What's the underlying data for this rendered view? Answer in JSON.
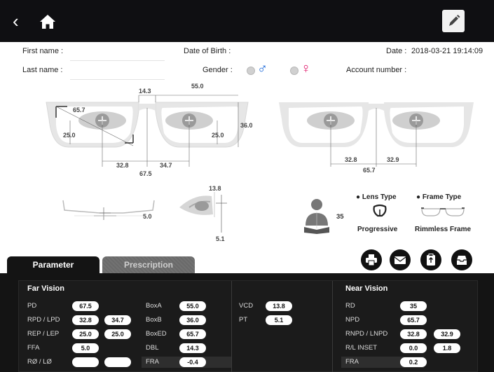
{
  "patient": {
    "first_name_label": "First name :",
    "last_name_label": "Last name :",
    "dob_label": "Date of Birth :",
    "gender_label": "Gender :",
    "date_label": "Date :",
    "date_value": "2018-03-21 19:14:09",
    "account_label": "Account number :",
    "male_symbol": "♂",
    "female_symbol": "♀",
    "male_color": "#1565d8",
    "female_color": "#e0196c"
  },
  "frame_front": {
    "bridge": "14.3",
    "lens_width": "55.0",
    "ffa_angle": "65.7",
    "left_height": "25.0",
    "right_height": "25.0",
    "frame_height": "36.0",
    "left_pd": "32.8",
    "right_pd": "34.7",
    "total_pd": "67.5"
  },
  "frame_near": {
    "left_pd": "32.8",
    "right_pd": "32.9",
    "total_pd": "65.7"
  },
  "wrap": {
    "value": "5.0"
  },
  "side": {
    "vcd": "13.8",
    "pantoscopic": "5.1"
  },
  "reading": {
    "distance": "35"
  },
  "types": {
    "lens_label": "Lens Type",
    "frame_label": "Frame Type",
    "lens_value": "Progressive",
    "frame_value": "Rimmless Frame"
  },
  "tabs": {
    "parameter": "Parameter",
    "prescription": "Prescription"
  },
  "far": {
    "title": "Far Vision",
    "pd_label": "PD",
    "pd": "67.5",
    "rpd_label": "RPD / LPD",
    "rpd": "32.8",
    "lpd": "34.7",
    "rep_label": "REP / LEP",
    "rep": "25.0",
    "lep": "25.0",
    "ffa_label": "FFA",
    "ffa": "5.0",
    "rl_label": "RØ / LØ",
    "r0": "",
    "l0": "",
    "boxa_label": "BoxA",
    "boxa": "55.0",
    "boxb_label": "BoxB",
    "boxb": "36.0",
    "boxed_label": "BoxED",
    "boxed": "65.7",
    "dbl_label": "DBL",
    "dbl": "14.3",
    "fra_label": "FRA",
    "fra": "-0.4"
  },
  "mid": {
    "vcd_label": "VCD",
    "vcd": "13.8",
    "pt_label": "PT",
    "pt": "5.1"
  },
  "near": {
    "title": "Near Vision",
    "rd_label": "RD",
    "rd": "35",
    "npd_label": "NPD",
    "npd": "65.7",
    "rnpd_label": "RNPD / LNPD",
    "rnpd": "32.8",
    "lnpd": "32.9",
    "inset_label": "R/L INSET",
    "rinset": "0.0",
    "linset": "1.8",
    "fra_label": "FRA",
    "fra": "0.2"
  }
}
